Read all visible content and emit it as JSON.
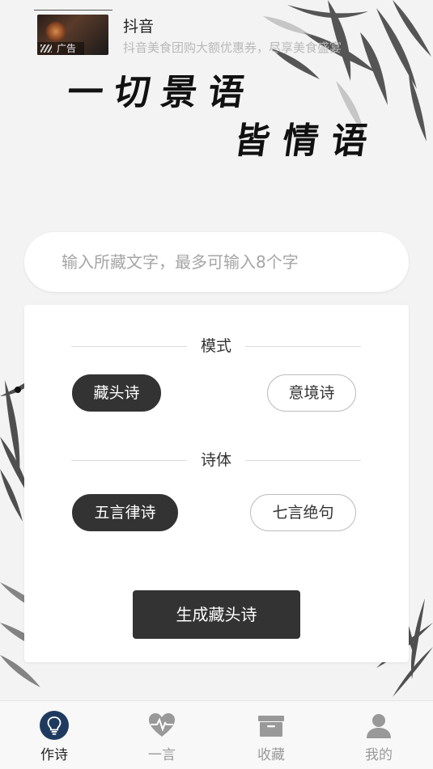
{
  "ad": {
    "title": "抖音",
    "description": "抖音美食团购大额优惠券，尽享美食盛宴",
    "badge": "广告"
  },
  "banner": {
    "line1": "一切景语",
    "line2": "皆情语"
  },
  "input": {
    "placeholder": "输入所藏文字，最多可输入8个字",
    "value": ""
  },
  "mode": {
    "title": "模式",
    "options": [
      {
        "label": "藏头诗",
        "selected": true
      },
      {
        "label": "意境诗",
        "selected": false
      }
    ]
  },
  "form": {
    "title": "诗体",
    "options": [
      {
        "label": "五言律诗",
        "selected": true
      },
      {
        "label": "七言绝句",
        "selected": false
      }
    ]
  },
  "generate_label": "生成藏头诗",
  "tabs": [
    {
      "label": "作诗",
      "icon": "lightbulb-icon",
      "active": true
    },
    {
      "label": "一言",
      "icon": "heartbeat-icon",
      "active": false
    },
    {
      "label": "收藏",
      "icon": "archive-box-icon",
      "active": false
    },
    {
      "label": "我的",
      "icon": "user-icon",
      "active": false
    }
  ],
  "colors": {
    "background": "#f3f3f3",
    "accent": "#333333",
    "tab_active_icon": "#1e3a5f",
    "tab_inactive": "#999999"
  }
}
